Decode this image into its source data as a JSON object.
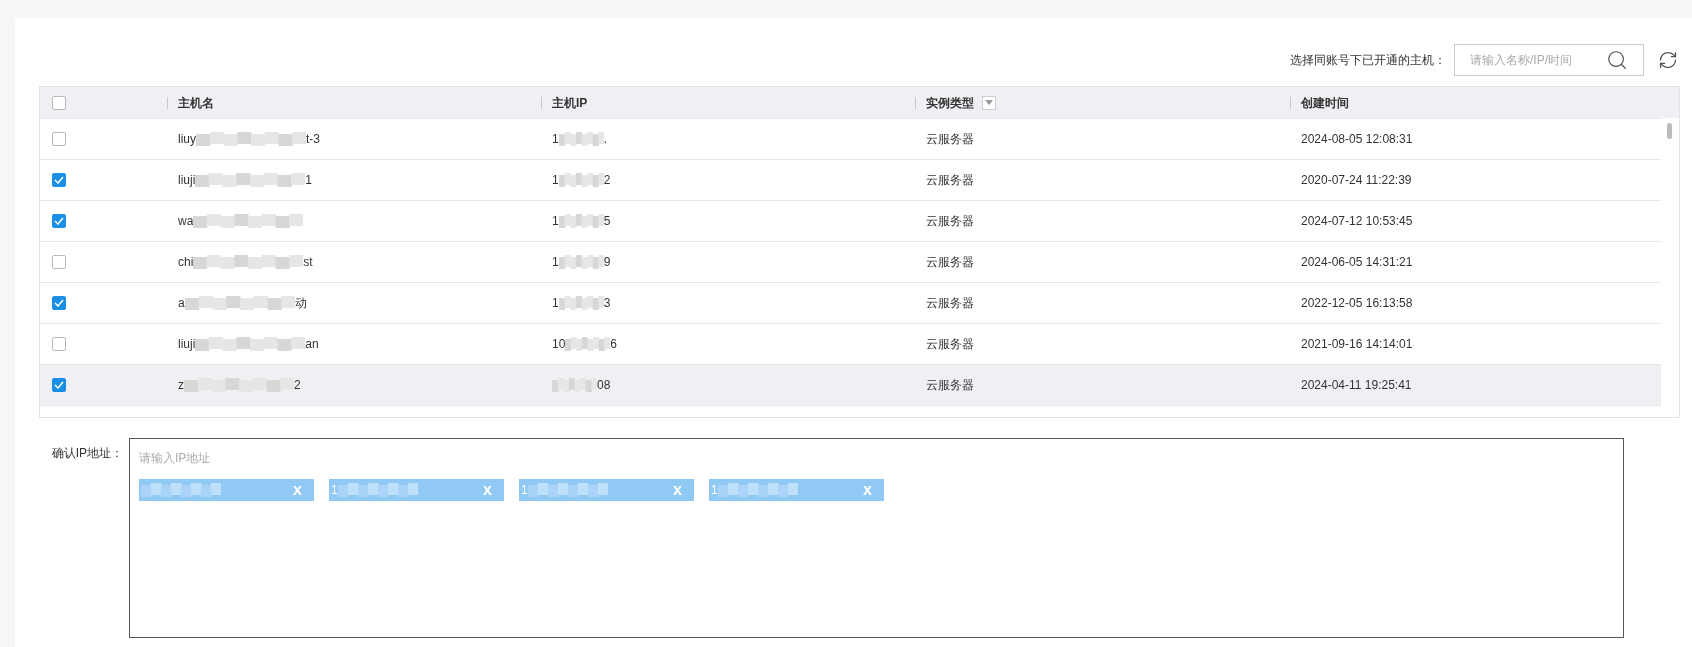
{
  "search": {
    "label": "选择同账号下已开通的主机：",
    "placeholder": "请输入名称/IP/时间"
  },
  "table": {
    "all_checked": false,
    "columns": [
      {
        "label": "主机名",
        "filter": false
      },
      {
        "label": "主机IP",
        "filter": false
      },
      {
        "label": "实例类型",
        "filter": true
      },
      {
        "label": "创建时间",
        "filter": false
      }
    ],
    "rows": [
      {
        "checked": false,
        "highlighted": false,
        "name_start": "liuy",
        "name_end": "t-3",
        "ip_start": "1",
        "ip_end": ".",
        "type": "云服务器",
        "created": "2024-08-05 12:08:31"
      },
      {
        "checked": true,
        "highlighted": false,
        "name_start": "liuji",
        "name_end": "1",
        "ip_start": "1",
        "ip_end": "2",
        "type": "云服务器",
        "created": "2020-07-24 11:22:39"
      },
      {
        "checked": true,
        "highlighted": false,
        "name_start": "wa",
        "ip_start": "1",
        "ip_end": "5",
        "type": "云服务器",
        "created": "2024-07-12 10:53:45"
      },
      {
        "checked": false,
        "highlighted": false,
        "name_start": "chi",
        "name_end": "st",
        "ip_start": "1",
        "ip_end": "9",
        "type": "云服务器",
        "created": "2024-06-05 14:31:21"
      },
      {
        "checked": true,
        "highlighted": false,
        "name_start": "a",
        "name_end": "动",
        "ip_start": "1",
        "ip_end": "3",
        "type": "云服务器",
        "created": "2022-12-05 16:13:58"
      },
      {
        "checked": false,
        "highlighted": false,
        "name_start": "liuji",
        "name_end": "an",
        "ip_start": "10",
        "ip_end": "6",
        "type": "云服务器",
        "created": "2021-09-16 14:14:01"
      },
      {
        "checked": true,
        "highlighted": true,
        "name_start": "z",
        "name_end": "2",
        "ip_end": "08",
        "type": "云服务器",
        "created": "2024-04-11 19:25:41"
      }
    ]
  },
  "ip_input": {
    "label": "确认IP地址：",
    "placeholder": "请输入IP地址",
    "tags": [
      {
        "remove": "x"
      },
      {
        "text": "1",
        "remove": "x"
      },
      {
        "text": "1",
        "remove": "x"
      },
      {
        "text": "1",
        "remove": "x"
      }
    ]
  }
}
